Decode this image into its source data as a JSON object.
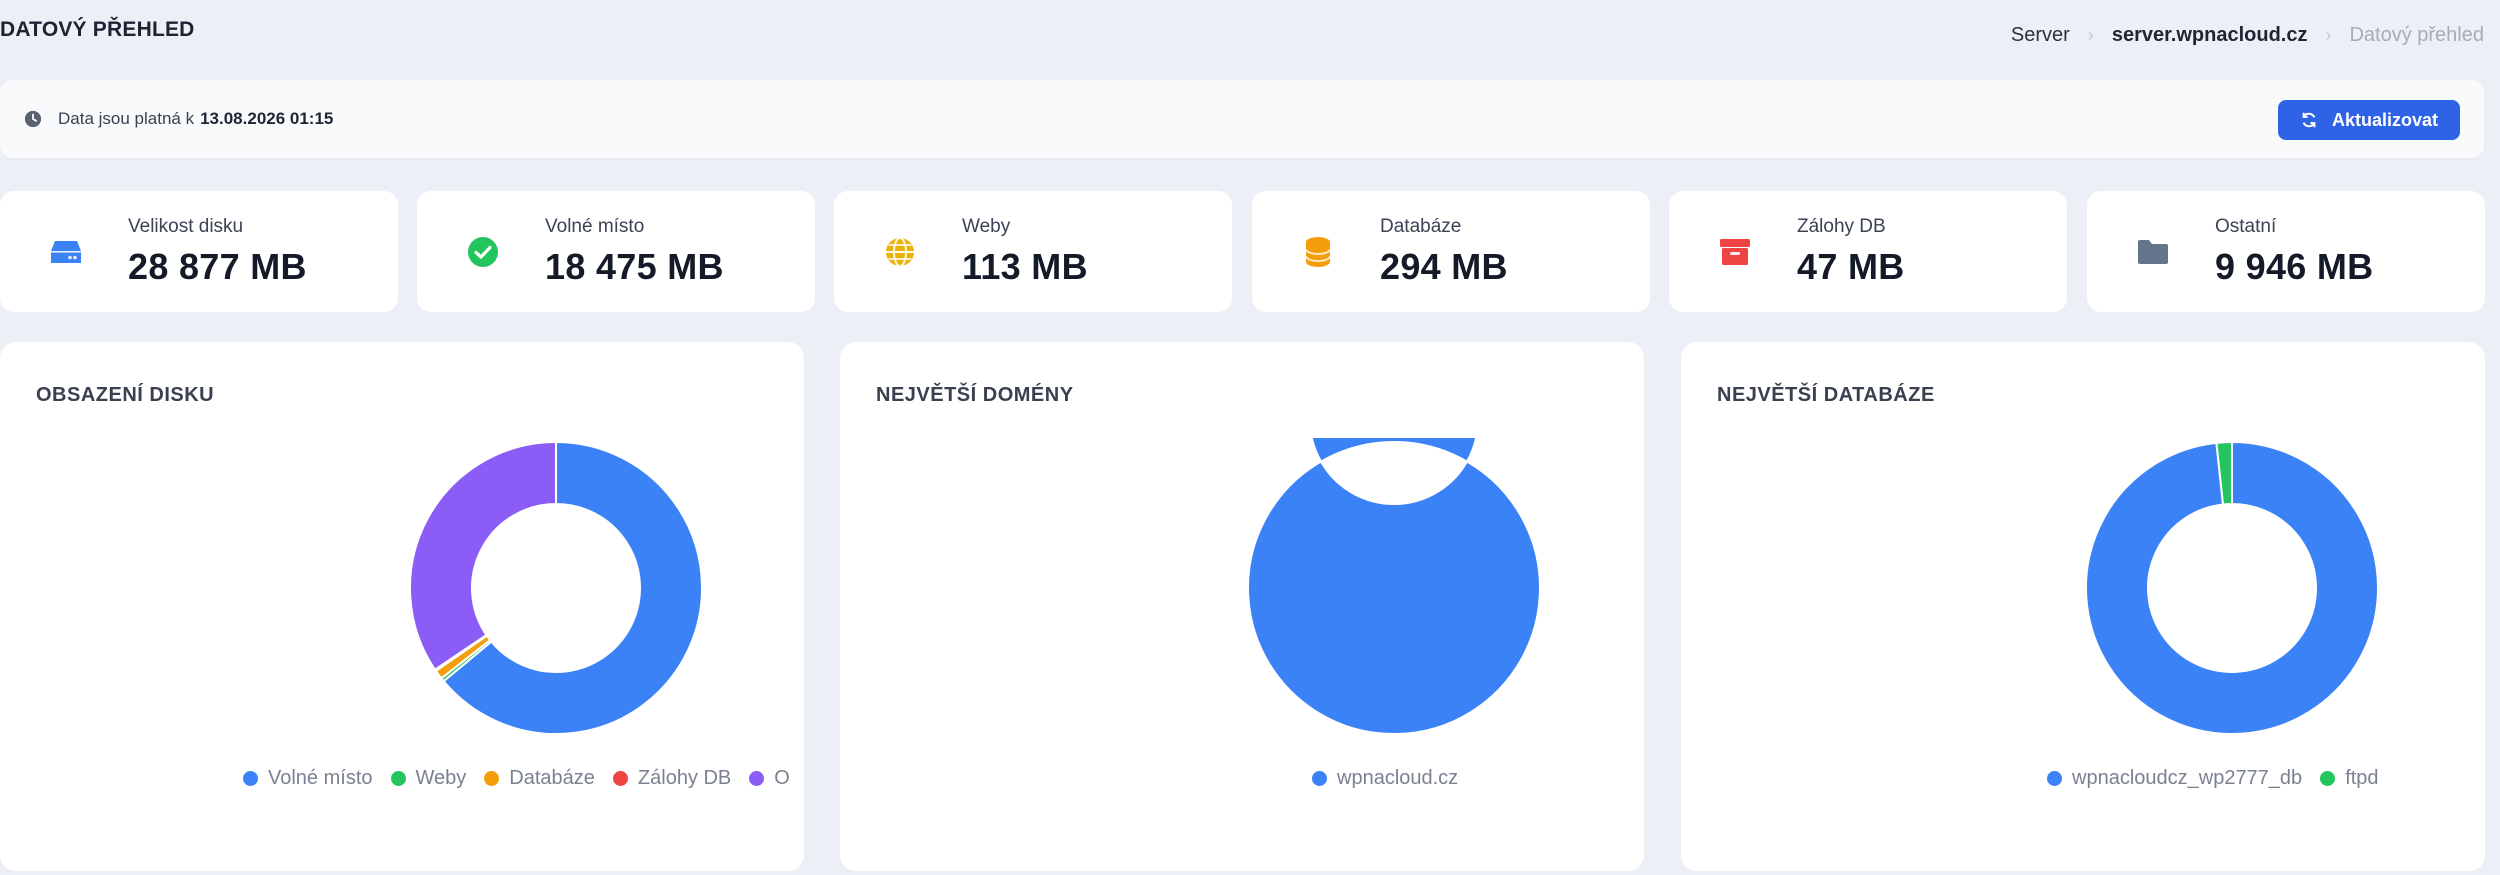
{
  "header": {
    "title": "DATOVÝ PŘEHLED",
    "breadcrumb": [
      "Server",
      "server.wpnacloud.cz",
      "Datový přehled"
    ]
  },
  "info": {
    "text": "Data jsou platná k",
    "date": "13.08.2026 01:15",
    "refresh_label": "Aktualizovat"
  },
  "stats": [
    {
      "label": "Velikost disku",
      "value": "28 877 MB",
      "icon": "disk-icon",
      "color": "#3b82f6",
      "bg": "#e8f0fd"
    },
    {
      "label": "Volné místo",
      "value": "18 475 MB",
      "icon": "check-circle-icon",
      "color": "#22c55e",
      "bg": "#e9f8ee"
    },
    {
      "label": "Weby",
      "value": "113 MB",
      "icon": "globe-icon",
      "color": "#eab308",
      "bg": "#fdf7e3"
    },
    {
      "label": "Databáze",
      "value": "294 MB",
      "icon": "database-icon",
      "color": "#f59e0b",
      "bg": "#fdf1dc"
    },
    {
      "label": "Zálohy DB",
      "value": "47 MB",
      "icon": "archive-icon",
      "color": "#ef4444",
      "bg": "#fdeaea"
    },
    {
      "label": "Ostatní",
      "value": "9 946 MB",
      "icon": "folder-icon",
      "color": "#64748b",
      "bg": "#eef0f4"
    }
  ],
  "chart_data": [
    {
      "type": "pie",
      "title": "OBSAZENÍ DISKU",
      "categories": [
        "Volné místo",
        "Weby",
        "Databáze",
        "Zálohy DB",
        "Ostatní"
      ],
      "legend_visible": [
        "Volné místo",
        "Weby",
        "Databáze",
        "Zálohy DB",
        "O"
      ],
      "values": [
        18475,
        113,
        294,
        47,
        9946
      ],
      "colors": [
        "#3b82f6",
        "#22c55e",
        "#f59e0b",
        "#ef4444",
        "#8b5cf6"
      ]
    },
    {
      "type": "pie",
      "title": "NEJVĚTŠÍ DOMÉNY",
      "categories": [
        "wpnacloud.cz"
      ],
      "legend_visible": [
        "wpnacloud.cz"
      ],
      "values": [
        113
      ],
      "colors": [
        "#3b82f6"
      ]
    },
    {
      "type": "pie",
      "title": "NEJVĚTŠÍ DATABÁZE",
      "categories": [
        "wpnacloudcz_wp2777_db",
        "ftpd"
      ],
      "legend_visible": [
        "wpnacloudcz_wp2777_db",
        "ftpd"
      ],
      "values": [
        289,
        5
      ],
      "colors": [
        "#3b82f6",
        "#22c55e"
      ]
    }
  ]
}
